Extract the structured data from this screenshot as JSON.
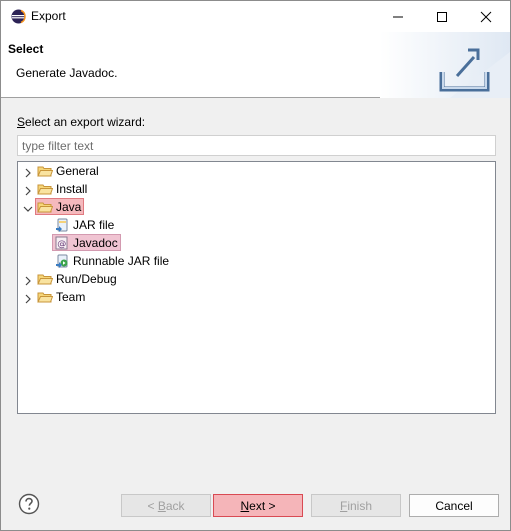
{
  "window": {
    "title": "Export"
  },
  "header": {
    "title": "Select",
    "description": "Generate Javadoc."
  },
  "wizard": {
    "select_label_accel": "S",
    "select_label_rest": "elect an export wizard:",
    "filter_placeholder": "type filter text",
    "tree": [
      {
        "label": "General",
        "expanded": false
      },
      {
        "label": "Install",
        "expanded": false
      },
      {
        "label": "Java",
        "expanded": true,
        "highlighted": true,
        "children": [
          "JAR file",
          "Javadoc",
          "Runnable JAR file"
        ]
      },
      {
        "label": "Run/Debug",
        "expanded": false
      },
      {
        "label": "Team",
        "expanded": false
      }
    ],
    "selected_child": "Javadoc"
  },
  "buttons": {
    "back_prefix": "< ",
    "back_accel": "B",
    "back_rest": "ack",
    "next_accel": "N",
    "next_rest": "ext >",
    "finish_accel": "F",
    "finish_rest": "inish",
    "cancel": "Cancel",
    "back_enabled": false,
    "finish_enabled": false
  },
  "colors": {
    "highlight": "#f5b9bd",
    "highlight_border": "#e07a80",
    "next_bg": "#f5b5b9",
    "folder": "#f2c866",
    "accent": "#2b6cb0"
  }
}
